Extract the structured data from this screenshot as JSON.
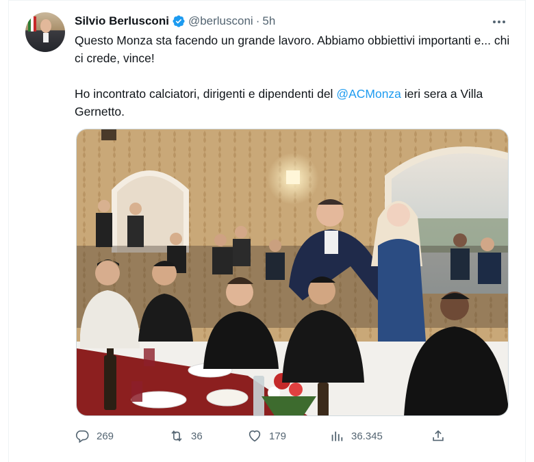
{
  "tweet": {
    "author_name": "Silvio Berlusconi",
    "handle": "@berlusconi",
    "separator": "·",
    "time": "5h",
    "text_line1": "Questo Monza sta facendo un grande lavoro. Abbiamo obbiettivi importanti e... chi ci crede, vince!",
    "text_line2_before": "Ho incontrato calciatori, dirigenti e dipendenti del ",
    "mention": "@ACMonza",
    "text_line2_after": " ieri sera a Villa Gernetto."
  },
  "actions": {
    "replies": "269",
    "retweets": "36",
    "likes": "179",
    "views": "36.345"
  },
  "icons": {
    "verified": "verified-badge-icon",
    "more": "more-icon",
    "reply": "reply-icon",
    "retweet": "retweet-icon",
    "like": "heart-icon",
    "views": "analytics-icon",
    "share": "share-icon"
  },
  "colors": {
    "accent": "#1d9bf0",
    "secondary_text": "#536471",
    "primary_text": "#0f1419",
    "border": "#cfd9de"
  }
}
